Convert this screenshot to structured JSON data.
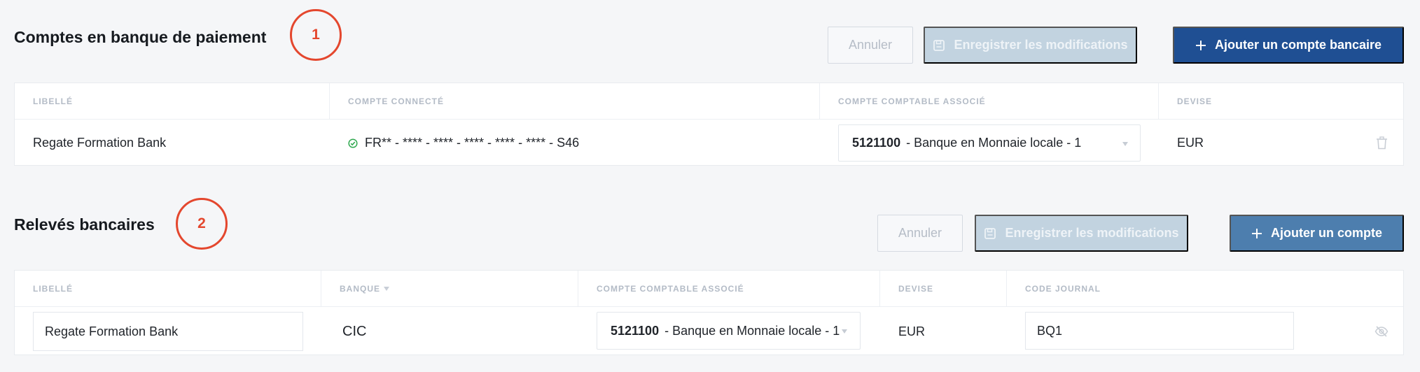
{
  "payment_section": {
    "title": "Comptes en banque de paiement",
    "marker": "1",
    "cancel_label": "Annuler",
    "save_label": "Enregistrer les modifications",
    "add_label": "Ajouter un compte bancaire",
    "columns": [
      "LIBELLÉ",
      "COMPTE CONNECTÉ",
      "COMPTE COMPTABLE ASSOCIÉ",
      "DEVISE"
    ],
    "row": {
      "label": "Regate Formation Bank",
      "connected_account": "FR** - **** - **** - **** - **** - **** - S46",
      "account_code": "5121100",
      "account_name": "- Banque en Monnaie locale - 1",
      "currency": "EUR"
    }
  },
  "statements_section": {
    "title": "Relevés bancaires",
    "marker": "2",
    "cancel_label": "Annuler",
    "save_label": "Enregistrer les modifications",
    "add_label": "Ajouter un compte",
    "columns": [
      "LIBELLÉ",
      "BANQUE",
      "COMPTE COMPTABLE ASSOCIÉ",
      "DEVISE",
      "CODE JOURNAL"
    ],
    "row": {
      "label": "Regate Formation Bank",
      "bank": "CIC",
      "account_code": "5121100",
      "account_name": "- Banque en Monnaie locale - 1",
      "currency": "EUR",
      "journal_code": "BQ1"
    }
  },
  "icons": {
    "save": "floppy-disk-icon",
    "add": "plus-icon",
    "connected": "check-circle-icon",
    "delete": "trash-icon",
    "hide": "eye-off-icon",
    "sort": "caret-down-icon"
  },
  "colors": {
    "primary": "#1f4f93",
    "primary_light": "#4d7eae",
    "disabled": "#c2d3e0",
    "marker": "#e4472e",
    "success": "#2fa84f"
  }
}
